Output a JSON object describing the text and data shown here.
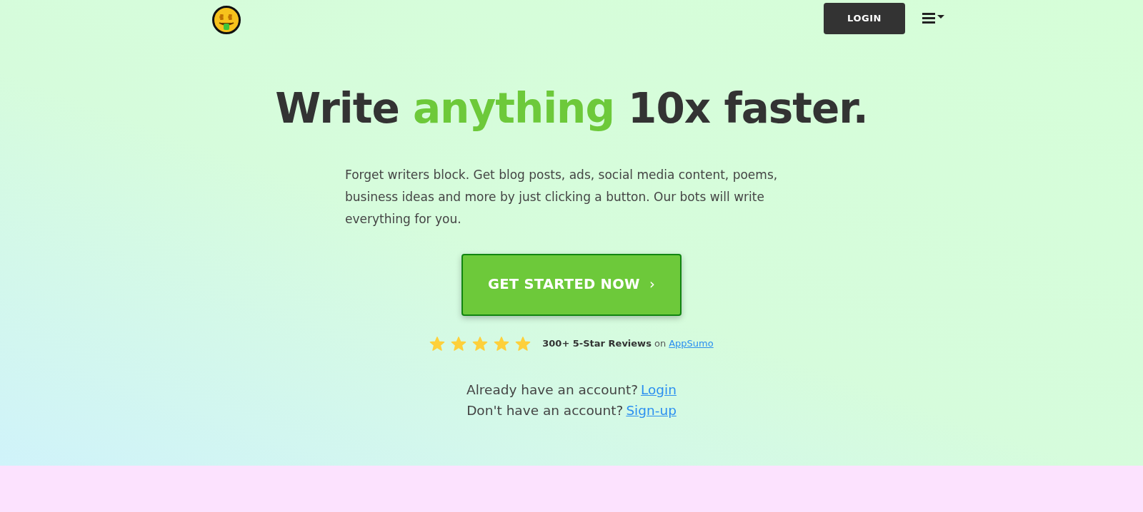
{
  "nav": {
    "login_button": "LOGIN",
    "menu_open": false
  },
  "headline": [
    {
      "text": "Write ",
      "accent": false
    },
    {
      "text": "anything",
      "accent": true
    },
    {
      "text": " 10x faster.",
      "accent": false
    }
  ],
  "intro": "Forget writers block. Get blog posts, ads, social media content, poems, business ideas and more by just clicking a button. Our bots will write everything for you.",
  "cta": {
    "label": "GET STARTED NOW",
    "chevron": "›"
  },
  "reviews": {
    "stars": 5,
    "text": "**300+ 5-Star Reviews** on",
    "link": "AppSumo"
  },
  "account_lines": [
    {
      "text": "Already have an account?",
      "link": "Login"
    },
    {
      "text": "Don't have an account?",
      "link": "Sign-up"
    }
  ]
}
